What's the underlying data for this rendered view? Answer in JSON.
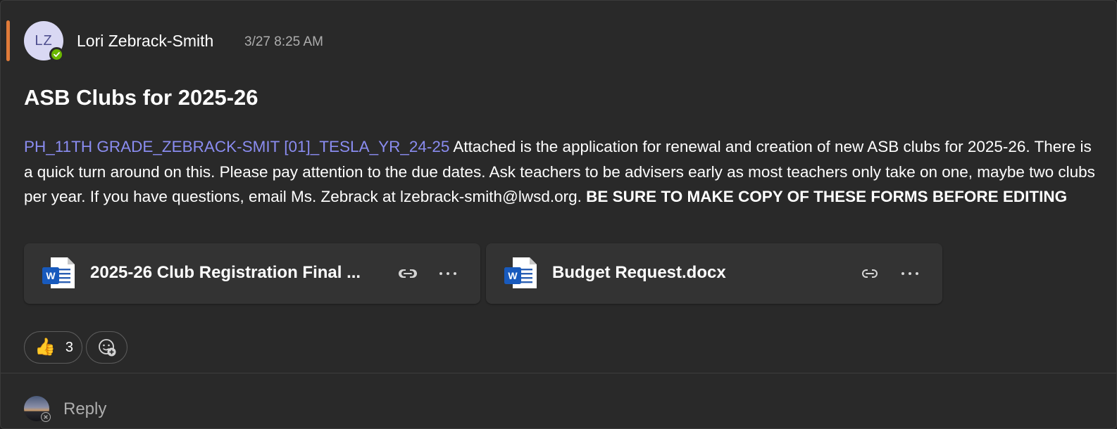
{
  "message": {
    "sender_initials": "LZ",
    "sender_name": "Lori Zebrack-Smith",
    "timestamp": "3/27 8:25 AM",
    "subject": "ASB Clubs for 2025-26",
    "mention": "PH_11TH GRADE_ZEBRACK-SMIT [01]_TESLA_YR_24-25",
    "body": " Attached is the application for renewal and creation of new ASB clubs for 2025-26. There is a quick turn around on this. Please pay attention to the due dates. Ask teachers to be advisers early as most teachers only take on one, maybe two clubs per year. If you have questions, email Ms. Zebrack at lzebrack-smith@lwsd.org. ",
    "body_bold": "BE SURE TO MAKE  COPY OF THESE FORMS BEFORE EDITING"
  },
  "attachments": [
    {
      "name": "2025-26 Club Registration Final ...",
      "icon": "word-doc-icon"
    },
    {
      "name": "Budget Request.docx",
      "icon": "word-doc-icon"
    }
  ],
  "reactions": [
    {
      "emoji": "👍",
      "count": "3"
    }
  ],
  "reply": {
    "label": "Reply"
  },
  "colors": {
    "accent": "#e07b39",
    "mention": "#8a8cf0",
    "presence": "#6bb700",
    "word_blue": "#185abd"
  }
}
